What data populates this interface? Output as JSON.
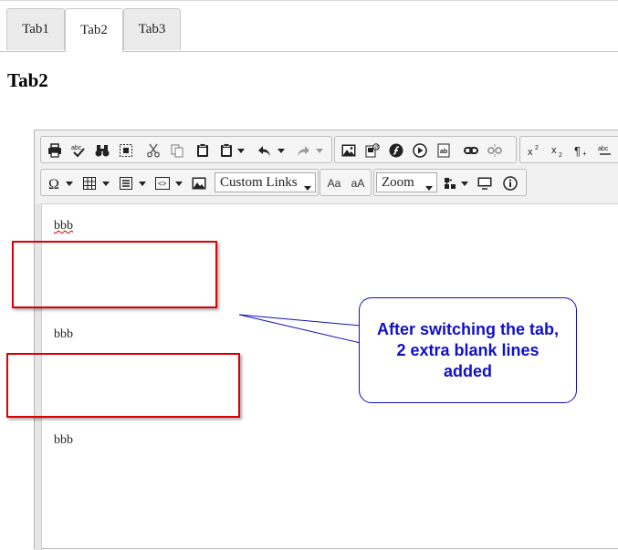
{
  "tabs": [
    {
      "label": "Tab1",
      "active": false
    },
    {
      "label": "Tab2",
      "active": true
    },
    {
      "label": "Tab3",
      "active": false
    }
  ],
  "page": {
    "heading": "Tab2"
  },
  "toolbar": {
    "row1_icons": [
      "print-icon",
      "spellcheck-icon",
      "find-icon",
      "select-all-icon",
      "cut-icon",
      "copy-icon",
      "paste-icon",
      "paste-special-icon",
      "undo-icon",
      "redo-icon",
      "image-icon",
      "image-gallery-icon",
      "flash-icon",
      "media-icon",
      "document-icon",
      "link-icon",
      "unlink-icon",
      "superscript-icon",
      "subscript-icon",
      "paragraph-icon",
      "spellcheck-abc-icon"
    ],
    "custom_links": "Custom Links",
    "font_smaller": "Aa",
    "font_larger": "aA",
    "zoom": "Zoom"
  },
  "content": {
    "paragraphs": [
      "bbb",
      "bbb",
      "bbb"
    ]
  },
  "annotation": {
    "text": "After switching the tab, 2 extra blank lines added",
    "color": "#1010c8",
    "box_color": "#e00000"
  }
}
